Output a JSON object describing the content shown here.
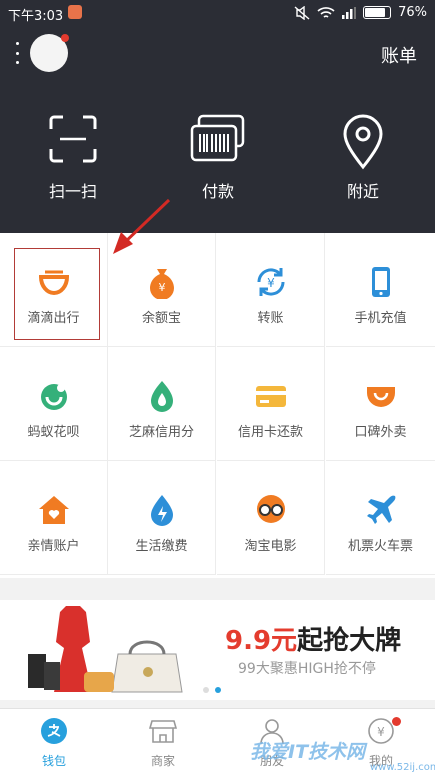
{
  "status_bar": {
    "time": "下午3:03",
    "battery": "76%"
  },
  "header": {
    "bill_label": "账单"
  },
  "quick_actions": [
    {
      "label": "扫一扫",
      "icon": "scan-icon"
    },
    {
      "label": "付款",
      "icon": "barcode-pay-icon"
    },
    {
      "label": "附近",
      "icon": "location-pin-icon"
    }
  ],
  "services": [
    {
      "label": "滴滴出行",
      "icon": "didi-icon",
      "color": "#f07b22"
    },
    {
      "label": "余额宝",
      "icon": "money-bag-icon",
      "color": "#f07b22"
    },
    {
      "label": "转账",
      "icon": "transfer-icon",
      "color": "#2d8fd8"
    },
    {
      "label": "手机充值",
      "icon": "phone-icon",
      "color": "#2d8fd8"
    },
    {
      "label": "蚂蚁花呗",
      "icon": "huabei-icon",
      "color": "#35b07a"
    },
    {
      "label": "芝麻信用分",
      "icon": "sesame-icon",
      "color": "#35b07a"
    },
    {
      "label": "信用卡还款",
      "icon": "credit-card-icon",
      "color": "#f4b73b"
    },
    {
      "label": "口碑外卖",
      "icon": "takeaway-icon",
      "color": "#f07b22"
    },
    {
      "label": "亲情账户",
      "icon": "family-home-icon",
      "color": "#f07b22"
    },
    {
      "label": "生活缴费",
      "icon": "utility-drop-icon",
      "color": "#2d8fd8"
    },
    {
      "label": "淘宝电影",
      "icon": "movie-glasses-icon",
      "color": "#f07b22"
    },
    {
      "label": "机票火车票",
      "icon": "airplane-icon",
      "color": "#2d8fd8"
    }
  ],
  "banner": {
    "price": "9.9元",
    "headline": "起抢大牌",
    "subline": "99大聚惠HIGH抢不停"
  },
  "tabs": [
    {
      "label": "钱包",
      "icon": "wallet-icon",
      "active": true
    },
    {
      "label": "商家",
      "icon": "store-icon",
      "active": false
    },
    {
      "label": "朋友",
      "icon": "friends-icon",
      "active": false
    },
    {
      "label": "我的",
      "icon": "profile-icon",
      "active": false
    }
  ],
  "watermark": {
    "text": "我爱IT技术网",
    "url": "www.52ij.com"
  },
  "colors": {
    "header_bg": "#2b2d35",
    "accent": "#27a0dd",
    "highlight_border": "#b23b37"
  }
}
